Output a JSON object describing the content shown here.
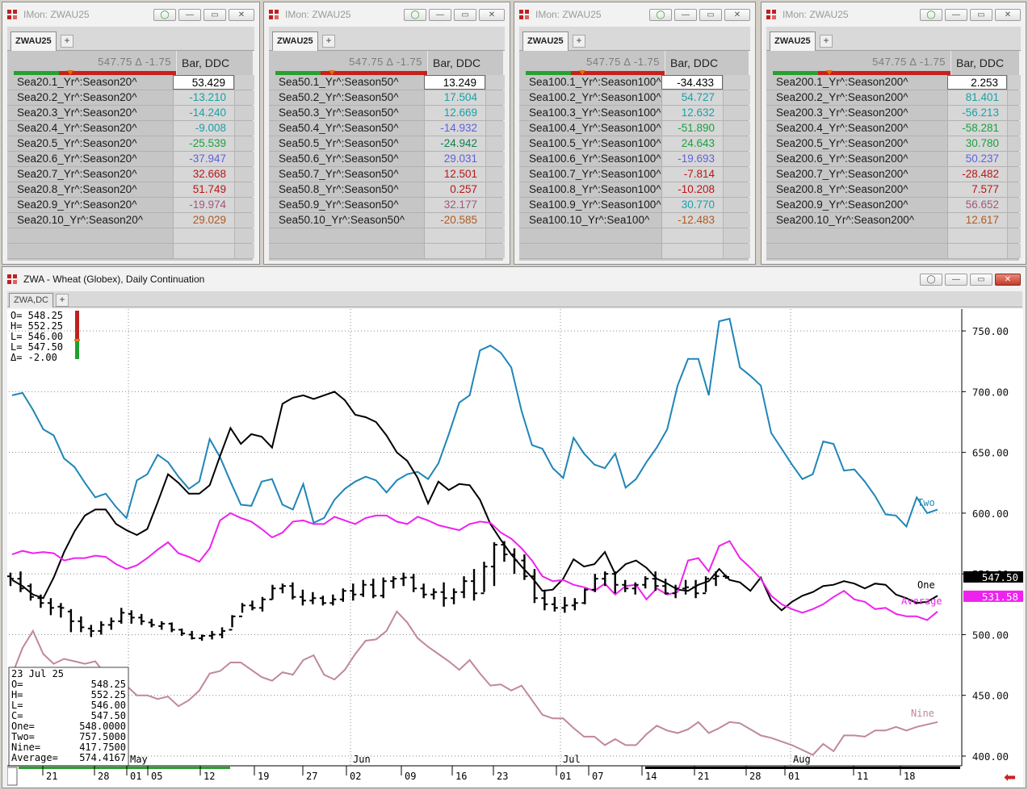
{
  "monitors": [
    {
      "title": "IMon: ZWAU25",
      "tab": "ZWAU25",
      "price": "547.75 Δ -1.75",
      "col_header": "Bar, DDC",
      "rows": [
        {
          "label": "Sea20.1_Yr^:Season20^",
          "value": "53.429"
        },
        {
          "label": "Sea20.2_Yr^:Season20^",
          "value": "-13.210"
        },
        {
          "label": "Sea20.3_Yr^:Season20^",
          "value": "-14.240"
        },
        {
          "label": "Sea20.4_Yr^:Season20^",
          "value": "-9.008"
        },
        {
          "label": "Sea20.5_Yr^:Season20^",
          "value": "-25.539"
        },
        {
          "label": "Sea20.6_Yr^:Season20^",
          "value": "-37.947"
        },
        {
          "label": "Sea20.7_Yr^:Season20^",
          "value": "32.668"
        },
        {
          "label": "Sea20.8_Yr^:Season20^",
          "value": "51.749"
        },
        {
          "label": "Sea20.9_Yr^:Season20^",
          "value": "-19.974"
        },
        {
          "label": "Sea20.10_Yr^:Season20^",
          "value": "29.029"
        }
      ]
    },
    {
      "title": "IMon: ZWAU25",
      "tab": "ZWAU25",
      "price": "547.75 Δ -1.75",
      "col_header": "Bar, DDC",
      "rows": [
        {
          "label": "Sea50.1_Yr^:Season50^",
          "value": "13.249"
        },
        {
          "label": "Sea50.2_Yr^:Season50^",
          "value": "17.504"
        },
        {
          "label": "Sea50.3_Yr^:Season50^",
          "value": "12.669"
        },
        {
          "label": "Sea50.4_Yr^:Season50^",
          "value": "-14.932"
        },
        {
          "label": "Sea50.5_Yr^:Season50^",
          "value": "-24.942"
        },
        {
          "label": "Sea50.6_Yr^:Season50^",
          "value": "29.031"
        },
        {
          "label": "Sea50.7_Yr^:Season50^",
          "value": "12.501"
        },
        {
          "label": "Sea50.8_Yr^:Season50^",
          "value": "0.257"
        },
        {
          "label": "Sea50.9_Yr^:Season50^",
          "value": "32.177"
        },
        {
          "label": "Sea50.10_Yr^:Season50^",
          "value": "-20.585"
        }
      ]
    },
    {
      "title": "IMon: ZWAU25",
      "tab": "ZWAU25",
      "price": "547.75 Δ -1.75",
      "col_header": "Bar, DDC",
      "rows": [
        {
          "label": "Sea100.1_Yr^:Season100^",
          "value": "-34.433"
        },
        {
          "label": "Sea100.2_Yr^:Season100^",
          "value": "54.727"
        },
        {
          "label": "Sea100.3_Yr^:Season100^",
          "value": "12.632"
        },
        {
          "label": "Sea100.4_Yr^:Season100^",
          "value": "-51.890"
        },
        {
          "label": "Sea100.5_Yr^:Season100^",
          "value": "24.643"
        },
        {
          "label": "Sea100.6_Yr^:Season100^",
          "value": "-19.693"
        },
        {
          "label": "Sea100.7_Yr^:Season100^",
          "value": "-7.814"
        },
        {
          "label": "Sea100.8_Yr^:Season100^",
          "value": "-10.208"
        },
        {
          "label": "Sea100.9_Yr^:Season100^",
          "value": "30.770"
        },
        {
          "label": "Sea100.10_Yr^:Sea100^",
          "value": "-12.483"
        }
      ]
    },
    {
      "title": "IMon: ZWAU25",
      "tab": "ZWAU25",
      "price": "547.75 Δ -1.75",
      "col_header": "Bar, DDC",
      "rows": [
        {
          "label": "Sea200.1_Yr^:Season200^",
          "value": "2.253"
        },
        {
          "label": "Sea200.2_Yr^:Season200^",
          "value": "81.401"
        },
        {
          "label": "Sea200.3_Yr^:Season200^",
          "value": "-56.213"
        },
        {
          "label": "Sea200.4_Yr^:Season200^",
          "value": "-58.281"
        },
        {
          "label": "Sea200.5_Yr^:Season200^",
          "value": "30.780"
        },
        {
          "label": "Sea200.6_Yr^:Season200^",
          "value": "50.237"
        },
        {
          "label": "Sea200.7_Yr^:Season200^",
          "value": "-28.482"
        },
        {
          "label": "Sea200.8_Yr^:Season200^",
          "value": "7.577"
        },
        {
          "label": "Sea200.9_Yr^:Season200^",
          "value": "56.652"
        },
        {
          "label": "Sea200.10_Yr^:Season200^",
          "value": "12.617"
        }
      ]
    }
  ],
  "colors": {
    "rows": [
      [
        "#000000",
        "#1aa0a8",
        "#1aa0a8",
        "#1aa0a8",
        "#1aa040",
        "#6060e0",
        "#b81818",
        "#b81818",
        "#a05878",
        "#b05a20"
      ],
      [
        "#000000",
        "#1aa0a8",
        "#1aa0a8",
        "#6060e0",
        "#108050",
        "#6060e0",
        "#b81818",
        "#b81818",
        "#a05878",
        "#b05a20"
      ],
      [
        "#000000",
        "#1aa0a8",
        "#1aa0a8",
        "#1aa040",
        "#1aa040",
        "#6060e0",
        "#b81818",
        "#b81818",
        "#1aa0a8",
        "#b05a20"
      ],
      [
        "#000000",
        "#1aa0a8",
        "#1aa0a8",
        "#1aa040",
        "#1aa040",
        "#6060e0",
        "#b81818",
        "#b81818",
        "#a05878",
        "#b05a20"
      ]
    ],
    "two": "#1f86b8",
    "one": "#000000",
    "average": "#ee22ee",
    "nine": "#c08898",
    "price_box": "#000000",
    "average_box": "#ee22ee",
    "up_arrow": "#d02020"
  },
  "chart": {
    "window_title": "ZWA - Wheat (Globex), Daily Continuation",
    "tab": "ZWA,DC",
    "ohlc_box": {
      "o": "O= 548.25",
      "h": "H= 552.25",
      "l": "L= 546.00",
      "c": "L= 547.50",
      "d": "Δ=  -2.00"
    },
    "info_box": {
      "date": "23 Jul 25",
      "rows": [
        {
          "k": "O=",
          "v": "548.25"
        },
        {
          "k": "H=",
          "v": "552.25"
        },
        {
          "k": "L=",
          "v": "546.00"
        },
        {
          "k": "C=",
          "v": "547.50"
        },
        {
          "k": "One=",
          "v": "548.0000"
        },
        {
          "k": "Two=",
          "v": "757.5000"
        },
        {
          "k": "Nine=",
          "v": "417.7500"
        },
        {
          "k": "Average=",
          "v": "574.4167"
        }
      ]
    },
    "price_tag": "547.50",
    "average_tag": "531.58"
  },
  "chart_data": {
    "type": "line",
    "y_ticks": [
      "750.00",
      "700.00",
      "650.00",
      "600.00",
      "550.00",
      "500.00",
      "450.00",
      "400.00"
    ],
    "ylim": [
      392,
      768
    ],
    "month_labels": [
      "May",
      "Jun",
      "Jul",
      "Aug"
    ],
    "date_labels": [
      "21",
      "28",
      "01",
      "05",
      "12",
      "19",
      "27",
      "02",
      "09",
      "16",
      "23",
      "01",
      "07",
      "14",
      "21",
      "28",
      "01",
      "11",
      "18"
    ],
    "series": [
      {
        "name": "Two",
        "values": [
          697,
          699,
          685,
          669,
          664,
          645,
          638,
          625,
          613,
          616,
          605,
          596,
          627,
          632,
          648,
          642,
          630,
          620,
          626,
          661,
          646,
          626,
          607,
          606,
          626,
          628,
          607,
          603,
          624,
          592,
          596,
          611,
          620,
          626,
          630,
          627,
          617,
          627,
          632,
          634,
          628,
          641,
          665,
          691,
          697,
          734,
          738,
          732,
          720,
          684,
          656,
          653,
          637,
          629,
          662,
          649,
          640,
          637,
          649,
          621,
          628,
          642,
          654,
          669,
          705,
          727,
          727,
          697,
          758,
          760,
          720,
          713,
          705,
          666,
          653,
          640,
          628,
          632,
          659,
          657,
          635,
          636,
          626,
          614,
          599,
          598,
          589,
          613,
          600,
          603
        ]
      },
      {
        "name": "One",
        "values": [
          545,
          540,
          533,
          530,
          547,
          568,
          585,
          598,
          603,
          603,
          591,
          586,
          582,
          587,
          609,
          632,
          625,
          616,
          616,
          623,
          647,
          670,
          657,
          665,
          663,
          654,
          690,
          695,
          697,
          694,
          697,
          700,
          693,
          681,
          679,
          675,
          664,
          650,
          643,
          629,
          608,
          626,
          619,
          624,
          623,
          611,
          591,
          578,
          566,
          556,
          547,
          536,
          537,
          546,
          562,
          556,
          558,
          568,
          550,
          558,
          561,
          555,
          546,
          542,
          537,
          536,
          541,
          544,
          554,
          545,
          543,
          536,
          547,
          528,
          520,
          527,
          532,
          535,
          540,
          541,
          544,
          542,
          538,
          542,
          541,
          533,
          530,
          526,
          527,
          532
        ]
      },
      {
        "name": "Average",
        "values": [
          566,
          569,
          567,
          568,
          567,
          561,
          563,
          563,
          565,
          564,
          558,
          554,
          557,
          563,
          570,
          576,
          567,
          564,
          560,
          571,
          594,
          600,
          596,
          593,
          587,
          580,
          584,
          593,
          594,
          591,
          591,
          597,
          594,
          591,
          596,
          598,
          598,
          593,
          591,
          597,
          594,
          590,
          588,
          586,
          591,
          593,
          592,
          584,
          579,
          571,
          561,
          548,
          544,
          545,
          541,
          539,
          536,
          542,
          533,
          540,
          541,
          529,
          538,
          533,
          535,
          561,
          563,
          552,
          573,
          577,
          563,
          555,
          546,
          532,
          525,
          521,
          518,
          521,
          525,
          531,
          536,
          529,
          527,
          521,
          522,
          517,
          515,
          515,
          512,
          519
        ]
      },
      {
        "name": "Nine",
        "values": [
          467,
          489,
          503,
          484,
          476,
          480,
          478,
          476,
          478,
          467,
          460,
          458,
          450,
          450,
          447,
          449,
          441,
          446,
          454,
          468,
          470,
          477,
          477,
          471,
          465,
          462,
          469,
          467,
          479,
          483,
          467,
          463,
          471,
          484,
          495,
          496,
          503,
          519,
          510,
          497,
          490,
          484,
          478,
          471,
          479,
          468,
          458,
          459,
          454,
          458,
          446,
          434,
          431,
          431,
          423,
          416,
          416,
          409,
          414,
          409,
          409,
          418,
          425,
          421,
          419,
          422,
          428,
          419,
          423,
          428,
          427,
          422,
          417,
          415,
          412,
          409,
          405,
          401,
          410,
          404,
          417,
          417,
          416,
          421,
          421,
          424,
          421,
          424,
          426,
          428
        ]
      },
      {
        "name": "Price",
        "ohlc": [
          [
            548,
            551,
            540,
            546
          ],
          [
            546,
            552,
            535,
            538
          ],
          [
            540,
            542,
            528,
            531
          ],
          [
            530,
            533,
            522,
            526
          ],
          [
            526,
            530,
            516,
            522
          ],
          [
            523,
            526,
            514,
            522
          ],
          [
            519,
            521,
            502,
            511
          ],
          [
            511,
            515,
            502,
            506
          ],
          [
            505,
            508,
            498,
            503
          ],
          [
            503,
            511,
            500,
            508
          ],
          [
            508,
            514,
            504,
            511
          ],
          [
            511,
            522,
            509,
            518
          ],
          [
            517,
            520,
            509,
            514
          ],
          [
            514,
            517,
            508,
            511
          ],
          [
            510,
            513,
            506,
            508
          ],
          [
            507,
            511,
            504,
            509
          ],
          [
            509,
            510,
            502,
            504
          ],
          [
            504,
            505,
            499,
            501
          ],
          [
            500,
            503,
            496,
            497
          ],
          [
            497,
            500,
            495,
            499
          ],
          [
            499,
            503,
            496,
            500
          ],
          [
            500,
            506,
            497,
            503
          ],
          [
            504,
            516,
            506,
            515
          ],
          [
            515,
            526,
            518,
            524
          ],
          [
            524,
            528,
            520,
            522
          ],
          [
            522,
            531,
            519,
            529
          ],
          [
            529,
            541,
            529,
            538
          ],
          [
            538,
            542,
            534,
            540
          ],
          [
            540,
            543,
            529,
            531
          ],
          [
            531,
            537,
            524,
            528
          ],
          [
            528,
            535,
            525,
            530
          ],
          [
            530,
            532,
            524,
            526
          ],
          [
            526,
            533,
            524,
            529
          ],
          [
            529,
            538,
            527,
            536
          ],
          [
            536,
            542,
            528,
            533
          ],
          [
            533,
            545,
            531,
            541
          ],
          [
            541,
            546,
            530,
            532
          ],
          [
            532,
            547,
            530,
            544
          ],
          [
            544,
            548,
            538,
            546
          ],
          [
            546,
            551,
            540,
            547
          ],
          [
            547,
            550,
            535,
            538
          ],
          [
            538,
            542,
            530,
            533
          ],
          [
            533,
            538,
            529,
            535
          ],
          [
            535,
            543,
            523,
            530
          ],
          [
            530,
            538,
            525,
            535
          ],
          [
            535,
            548,
            530,
            544
          ],
          [
            544,
            554,
            528,
            534
          ],
          [
            534,
            560,
            535,
            556
          ],
          [
            556,
            576,
            540,
            574
          ],
          [
            574,
            577,
            560,
            566
          ],
          [
            566,
            571,
            550,
            561
          ],
          [
            561,
            566,
            545,
            548
          ],
          [
            548,
            554,
            526,
            530
          ],
          [
            530,
            537,
            520,
            525
          ],
          [
            525,
            531,
            519,
            522
          ],
          [
            522,
            531,
            518,
            524
          ],
          [
            524,
            530,
            520,
            526
          ],
          [
            526,
            538,
            525,
            537
          ],
          [
            537,
            550,
            535,
            546
          ],
          [
            546,
            552,
            540,
            550
          ],
          [
            550,
            552,
            534,
            541
          ],
          [
            541,
            545,
            535,
            538
          ],
          [
            538,
            543,
            533,
            541
          ],
          [
            541,
            548,
            538,
            546
          ],
          [
            546,
            552,
            536,
            540
          ],
          [
            540,
            546,
            533,
            534
          ],
          [
            534,
            541,
            530,
            538
          ],
          [
            538,
            545,
            533,
            539
          ],
          [
            539,
            545,
            530,
            534
          ],
          [
            534,
            548,
            535,
            546
          ],
          [
            546,
            552,
            540,
            548
          ],
          [
            548,
            549,
            546,
            547.5
          ]
        ]
      }
    ]
  }
}
